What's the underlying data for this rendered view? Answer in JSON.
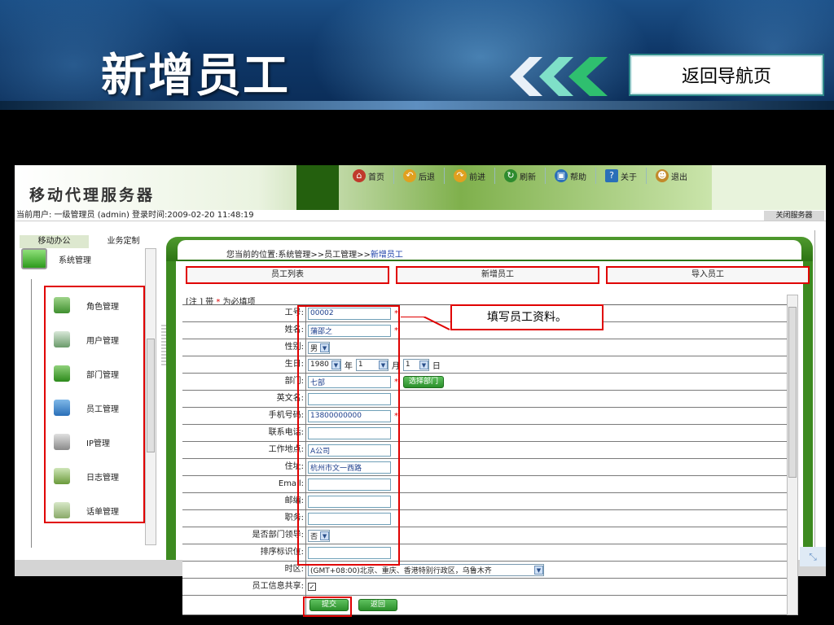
{
  "slide": {
    "title": "新增员工",
    "nav_back_label": "返回导航页"
  },
  "app": {
    "logo": "移动代理服务器",
    "toolbar": [
      {
        "label": "首页",
        "icon": "home-icon",
        "color": "#c0392b"
      },
      {
        "label": "后退",
        "icon": "back-icon",
        "color": "#e0a020"
      },
      {
        "label": "前进",
        "icon": "forward-icon",
        "color": "#e0a020"
      },
      {
        "label": "刷新",
        "icon": "refresh-icon",
        "color": "#2e8b2e"
      },
      {
        "label": "帮助",
        "icon": "help-book-icon",
        "color": "#2a6fb8"
      },
      {
        "label": "关于",
        "icon": "question-icon",
        "color": "#2a6fb8"
      },
      {
        "label": "退出",
        "icon": "exit-person-icon",
        "color": "#c28a2a"
      }
    ],
    "status_text": "当前用户: 一级管理员 (admin) 登录时间:2009-02-20 11:48:19",
    "close_server": "关闭服务器"
  },
  "sidebar": {
    "tabs": [
      "移动办公",
      "业务定制"
    ],
    "root": "系统管理",
    "items": [
      {
        "label": "角色管理",
        "icon": "role-icon"
      },
      {
        "label": "用户管理",
        "icon": "user-icon"
      },
      {
        "label": "部门管理",
        "icon": "department-icon"
      },
      {
        "label": "员工管理",
        "icon": "employee-icon"
      },
      {
        "label": "IP管理",
        "icon": "ip-icon"
      },
      {
        "label": "日志管理",
        "icon": "log-icon"
      },
      {
        "label": "话单管理",
        "icon": "bill-icon"
      }
    ]
  },
  "content": {
    "breadcrumb_prefix": "您当前的位置:系统管理>>员工管理>>",
    "breadcrumb_current": "新增员工",
    "subtabs": [
      "员工列表",
      "新增员工",
      "导入员工"
    ],
    "note_prefix": "[注 ] 带",
    "note_star": "*",
    "note_suffix": "为必填项"
  },
  "form": {
    "labels": {
      "emp_no": "工号:",
      "name": "姓名:",
      "gender": "性别:",
      "birthday": "生日:",
      "department": "部门:",
      "english_name": "英文名:",
      "mobile": "手机号码:",
      "phone": "联系电话:",
      "work_place": "工作地点:",
      "address": "住址:",
      "email": "Email:",
      "postcode": "邮编:",
      "position": "职务:",
      "is_leader": "是否部门领导:",
      "sort_id": "排序标识位:",
      "timezone": "时区:",
      "share": "员工信息共享:"
    },
    "values": {
      "emp_no": "00002",
      "name": "蒲邵之",
      "gender": "男",
      "birth_year": "1980",
      "birth_month": "1",
      "birth_day": "1",
      "department": "七部",
      "english_name": "",
      "mobile": "13800000000",
      "phone": "",
      "work_place": "A公司",
      "address": "杭州市文一西路",
      "email": "",
      "postcode": "",
      "position": "",
      "is_leader": "否",
      "sort_id": "",
      "timezone": "(GMT+08:00)北京、重庆、香港特别行政区，乌鲁木齐",
      "share_checked": "✓"
    },
    "units": {
      "year": "年",
      "month": "月",
      "day": "日"
    },
    "required_mark": "*",
    "select_dept_button": "选择部门",
    "submit_button": "提交",
    "back_button": "返回"
  },
  "callout": "填写员工资料。"
}
